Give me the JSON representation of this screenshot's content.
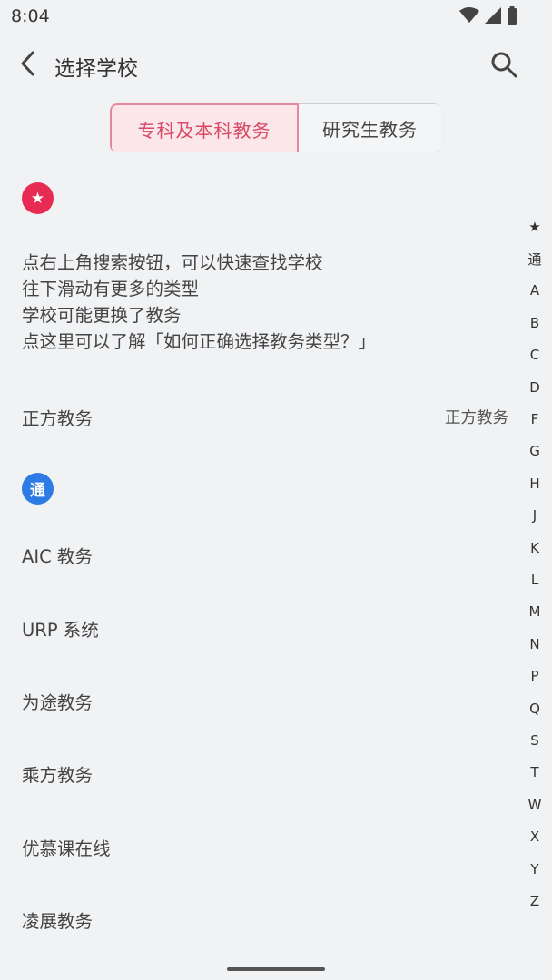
{
  "status_bar": {
    "time": "8:04"
  },
  "app_bar": {
    "title": "选择学校"
  },
  "tabs": [
    {
      "label": "专科及本科教务",
      "active": true
    },
    {
      "label": "研究生教务",
      "active": false
    }
  ],
  "sections": {
    "star_badge": "★",
    "tong_badge": "通"
  },
  "tips": [
    "点右上角搜索按钮，可以快速查找学校",
    "往下滑动有更多的类型",
    "学校可能更换了教务",
    "点这里可以了解「如何正确选择教务类型？」"
  ],
  "featured_row": {
    "label": "正方教务",
    "right": "正方教务"
  },
  "tong_rows": [
    "AIC 教务",
    "URP 系统",
    "为途教务",
    "乘方教务",
    "优慕课在线",
    "凌展教务"
  ],
  "index_letters": [
    "★",
    "通",
    "A",
    "B",
    "C",
    "D",
    "F",
    "G",
    "H",
    "J",
    "K",
    "L",
    "M",
    "N",
    "P",
    "Q",
    "S",
    "T",
    "W",
    "X",
    "Y",
    "Z"
  ],
  "colors": {
    "accent": "#d94a66",
    "star_badge": "#e82b52",
    "tong_badge": "#2f7be6"
  }
}
